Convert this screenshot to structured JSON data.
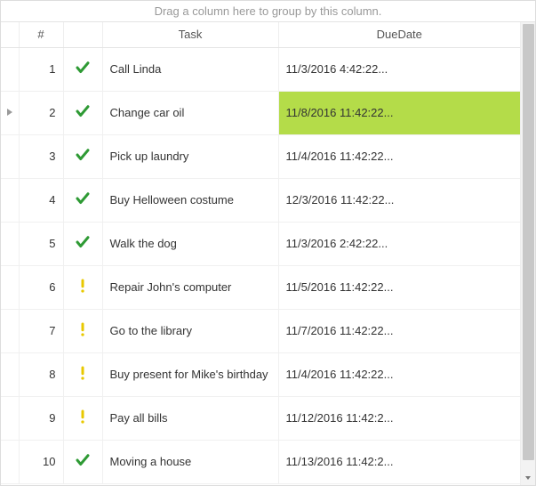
{
  "groupPanel": {
    "hint": "Drag a column here to group by this column."
  },
  "columns": {
    "indicator": "",
    "number": "#",
    "icon": "",
    "task": "Task",
    "dueDate": "DueDate"
  },
  "icons": {
    "check": {
      "color": "#2e9a34"
    },
    "exclaim": {
      "color": "#e8c800"
    }
  },
  "highlight": {
    "row": 2,
    "col": "dueDate",
    "bg": "#b4dc49"
  },
  "activeRow": 2,
  "rows": [
    {
      "n": 1,
      "icon": "check",
      "task": "Call Linda",
      "due": "11/3/2016 4:42:22..."
    },
    {
      "n": 2,
      "icon": "check",
      "task": "Change car oil",
      "due": "11/8/2016 11:42:22..."
    },
    {
      "n": 3,
      "icon": "check",
      "task": "Pick up laundry",
      "due": "11/4/2016 11:42:22..."
    },
    {
      "n": 4,
      "icon": "check",
      "task": "Buy Helloween costume",
      "due": "12/3/2016 11:42:22..."
    },
    {
      "n": 5,
      "icon": "check",
      "task": "Walk the dog",
      "due": "11/3/2016 2:42:22..."
    },
    {
      "n": 6,
      "icon": "exclaim",
      "task": "Repair John's computer",
      "due": "11/5/2016 11:42:22..."
    },
    {
      "n": 7,
      "icon": "exclaim",
      "task": "Go to the library",
      "due": "11/7/2016 11:42:22..."
    },
    {
      "n": 8,
      "icon": "exclaim",
      "task": "Buy present for Mike's birthday",
      "due": "11/4/2016 11:42:22..."
    },
    {
      "n": 9,
      "icon": "exclaim",
      "task": "Pay all bills",
      "due": "11/12/2016 11:42:2..."
    },
    {
      "n": 10,
      "icon": "check",
      "task": "Moving a house",
      "due": "11/13/2016 11:42:2..."
    }
  ]
}
